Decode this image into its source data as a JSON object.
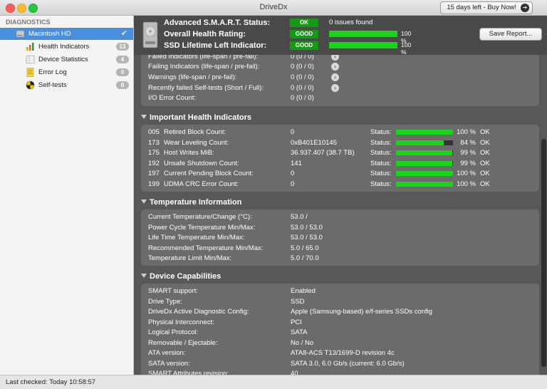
{
  "window": {
    "title": "DriveDx",
    "buy_label": "15 days left - Buy Now!"
  },
  "sidebar": {
    "heading": "DIAGNOSTICS",
    "items": [
      {
        "label": "Macintosh HD",
        "badge": ""
      },
      {
        "label": "Health Indicators",
        "badge": "13"
      },
      {
        "label": "Device Statistics",
        "badge": "4"
      },
      {
        "label": "Error Log",
        "badge": "0"
      },
      {
        "label": "Self-tests",
        "badge": "0"
      }
    ]
  },
  "header": {
    "smart_label": "Advanced S.M.A.R.T. Status:",
    "smart_badge": "OK",
    "smart_text": "0 issues found",
    "health_label": "Overall Health Rating:",
    "health_badge": "GOOD",
    "health_pct": "100 %",
    "health_value": 1.0,
    "lifetime_label": "SSD Lifetime Left Indicator:",
    "lifetime_badge": "GOOD",
    "lifetime_pct": "100 %",
    "lifetime_value": 1.0,
    "save_label": "Save Report..."
  },
  "summary": {
    "rows": [
      {
        "label": "Failed Indicators (life-span / pre-fail):",
        "value": "0 (0 / 0)"
      },
      {
        "label": "Failing Indicators (life-span / pre-fail):",
        "value": "0 (0 / 0)"
      },
      {
        "label": "Warnings (life-span / pre-fail):",
        "value": "0 (0 / 0)"
      },
      {
        "label": "Recently failed Self-tests (Short / Full):",
        "value": "0 (0 / 0)"
      },
      {
        "label": "I/O Error Count:",
        "value": "0 (0 / 0)"
      }
    ]
  },
  "important": {
    "title": "Important Health Indicators",
    "status_label": "Status:",
    "rows": [
      {
        "id": "005",
        "name": "Retired Block Count:",
        "value": "0",
        "pct": "100 %",
        "fill": 1.0,
        "ok": "OK"
      },
      {
        "id": "173",
        "name": "Wear Leveling Count:",
        "value": "0xB401E10145",
        "pct": "84 %",
        "fill": 0.84,
        "ok": "OK"
      },
      {
        "id": "175",
        "name": "Host Writes MiB:",
        "value": "36.937.407 (38.7 TB)",
        "pct": "99 %",
        "fill": 0.99,
        "ok": "OK"
      },
      {
        "id": "192",
        "name": "Unsafe Shutdown Count:",
        "value": "141",
        "pct": "99 %",
        "fill": 0.99,
        "ok": "OK"
      },
      {
        "id": "197",
        "name": "Current Pending Block Count:",
        "value": "0",
        "pct": "100 %",
        "fill": 1.0,
        "ok": "OK"
      },
      {
        "id": "199",
        "name": "UDMA CRC Error Count:",
        "value": "0",
        "pct": "100 %",
        "fill": 1.0,
        "ok": "OK"
      }
    ]
  },
  "temperature": {
    "title": "Temperature Information",
    "rows": [
      {
        "label": "Current Temperature/Change (°C):",
        "value": "53.0 /"
      },
      {
        "label": "Power Cycle Temperature Min/Max:",
        "value": "53.0 / 53.0"
      },
      {
        "label": "Life Time Temperature Min/Max:",
        "value": "53.0 / 53.0"
      },
      {
        "label": "Recommended Temperature Min/Max:",
        "value": "5.0   / 65.0"
      },
      {
        "label": "Temperature Limit Min/Max:",
        "value": "5.0   / 70.0"
      }
    ]
  },
  "capabilities": {
    "title": "Device Capabilities",
    "rows": [
      {
        "label": "SMART support:",
        "value": "Enabled"
      },
      {
        "label": "Drive Type:",
        "value": "SSD"
      },
      {
        "label": "DriveDx Active Diagnostic Config:",
        "value": "Apple (Samsung-based) e/f-series SSDs config"
      },
      {
        "label": "Physical Interconnect:",
        "value": "PCI"
      },
      {
        "label": "Logical Protocol:",
        "value": "SATA"
      },
      {
        "label": "Removable / Ejectable:",
        "value": "No / No"
      },
      {
        "label": "ATA version:",
        "value": "ATA8-ACS T13/1699-D revision 4c"
      },
      {
        "label": "SATA version:",
        "value": "SATA 3.0, 6.0 Gb/s (current: 6.0 Gb/s)"
      },
      {
        "label": "SMART Attributes revision:",
        "value": "40"
      }
    ]
  },
  "status_bar": {
    "text": "Last checked: Today 10:58:57"
  }
}
